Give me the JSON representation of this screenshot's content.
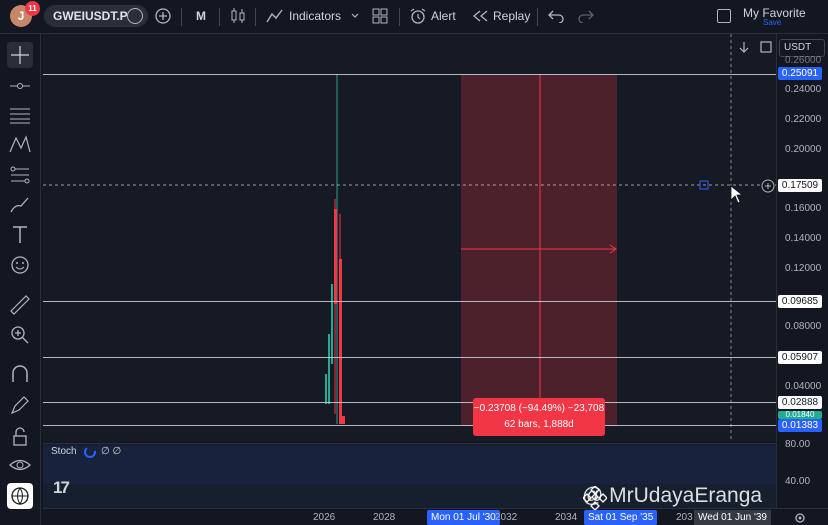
{
  "header": {
    "avatar_letter": "J",
    "notification_count": "11",
    "symbol": "GWEIUSDT.P",
    "interval": "M",
    "indicators_label": "Indicators",
    "alert_label": "Alert",
    "replay_label": "Replay",
    "favorites_title": "My Favorite",
    "favorites_save": "Save"
  },
  "price_axis": {
    "currency": "USDT",
    "ticks": [
      "0.26000",
      "0.24000",
      "0.22000",
      "0.20000",
      "0.16000",
      "0.14000",
      "0.12000",
      "0.08000",
      "0.04000"
    ],
    "labels": {
      "top": "0.25091",
      "cross": "0.17509",
      "line3": "0.09685",
      "line4": "0.05907",
      "line5": "0.02888",
      "green": "0.01840",
      "last": "0.01383"
    }
  },
  "measure": {
    "line1": "−0.23708 (−94.49%) −23,708",
    "line2": "62 bars, 1,888d"
  },
  "stoch": {
    "title": "Stoch",
    "values": "∅ ∅",
    "ticks": [
      "80.00",
      "40.00"
    ]
  },
  "time_axis": {
    "ticks": [
      "2026",
      "2028",
      "2032",
      "2034",
      "203"
    ],
    "range_start": "Mon 01 Jul '30",
    "range_end": "Sat 01 Sep '35",
    "crosshair": "Wed 01 Jun '39"
  },
  "watermark": "@ MrUdayaEranga",
  "logo_text": "17",
  "colors": {
    "accent": "#2962ff",
    "down": "#f23645",
    "up": "#22ab94"
  }
}
